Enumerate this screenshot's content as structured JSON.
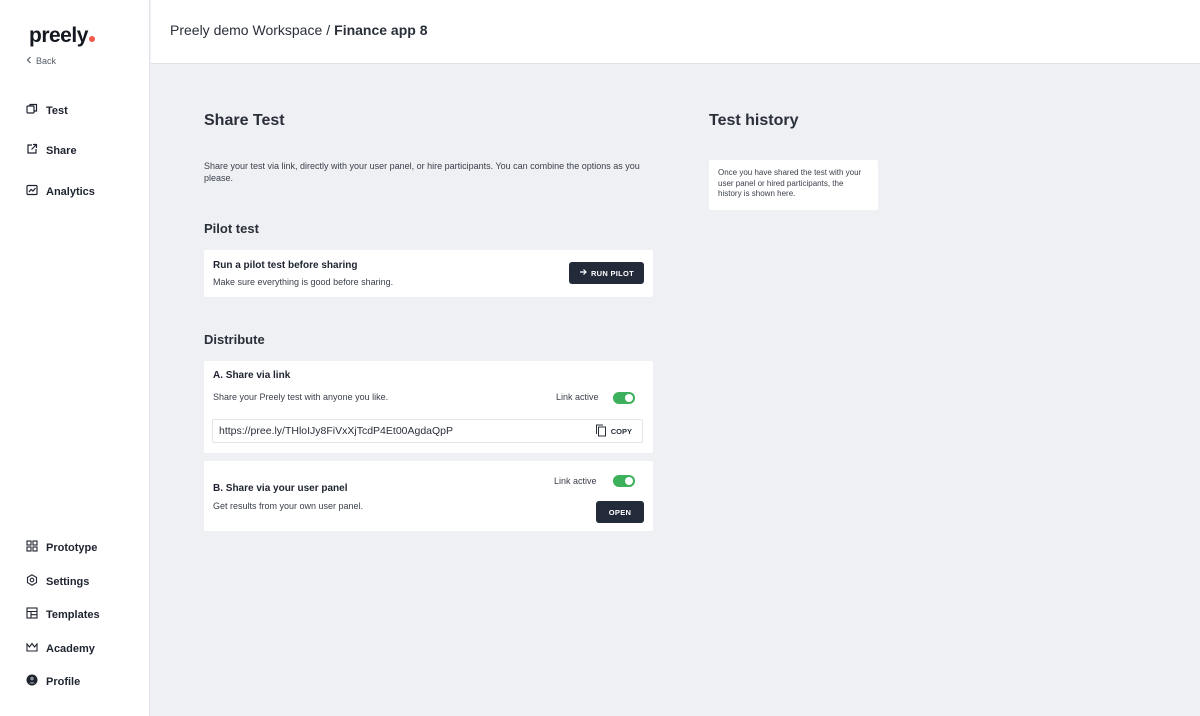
{
  "brand": {
    "name": "preely",
    "dot_color": "#f05a4a"
  },
  "sidebar": {
    "back_label": "Back",
    "top_items": [
      {
        "label": "Test",
        "icon": "test-icon"
      },
      {
        "label": "Share",
        "icon": "share-icon"
      },
      {
        "label": "Analytics",
        "icon": "analytics-icon"
      }
    ],
    "bottom_items": [
      {
        "label": "Prototype",
        "icon": "prototype-icon"
      },
      {
        "label": "Settings",
        "icon": "settings-icon"
      },
      {
        "label": "Templates",
        "icon": "templates-icon"
      },
      {
        "label": "Academy",
        "icon": "academy-icon"
      },
      {
        "label": "Profile",
        "icon": "profile-icon"
      }
    ]
  },
  "header": {
    "workspace": "Preely demo Workspace",
    "separator": "/",
    "project": "Finance app 8"
  },
  "main": {
    "title": "Share Test",
    "description": "Share your test via link, directly with your user panel, or hire participants. You can combine the options as you please.",
    "pilot": {
      "heading": "Pilot test",
      "card_title": "Run a pilot test before sharing",
      "card_text": "Make sure everything is good before sharing.",
      "button_label": "RUN PILOT"
    },
    "distribute": {
      "heading": "Distribute",
      "link": {
        "title": "A. Share via link",
        "text": "Share your Preely test with anyone you like.",
        "toggle_label": "Link active",
        "url": "https://pree.ly/THloIJy8FiVxXjTcdP4Et00AgdaQpP",
        "copy_label": "COPY"
      },
      "panel": {
        "title": "B. Share via your user panel",
        "text": "Get results from your own user panel.",
        "toggle_label": "Link active",
        "button_label": "OPEN"
      }
    }
  },
  "history": {
    "title": "Test history",
    "empty_text": "Once you have shared the test with your user panel or hired participants, the history is shown here."
  },
  "colors": {
    "accent_dark": "#232a3a",
    "toggle_on": "#3cb05a",
    "background": "#eef0f3"
  }
}
